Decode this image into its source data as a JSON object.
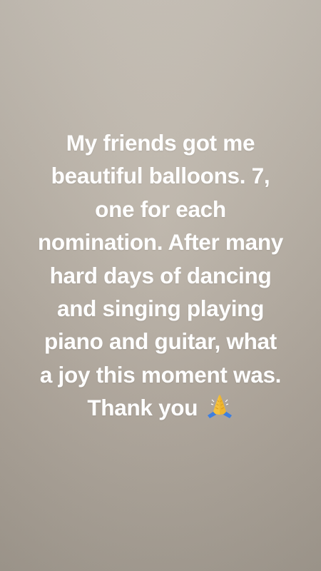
{
  "story": {
    "lines": [
      "My friends got me",
      "beautiful balloons. 7,",
      "one for each",
      "nomination. After many",
      "hard days of dancing",
      "and singing playing",
      "piano and guitar, what",
      "a joy this moment was.",
      "Thank you"
    ],
    "emoji_icon": "folded-hands-icon"
  },
  "colors": {
    "text": "#ffffff",
    "background_top": "#c9c2b8",
    "background_bottom": "#a79f94"
  }
}
